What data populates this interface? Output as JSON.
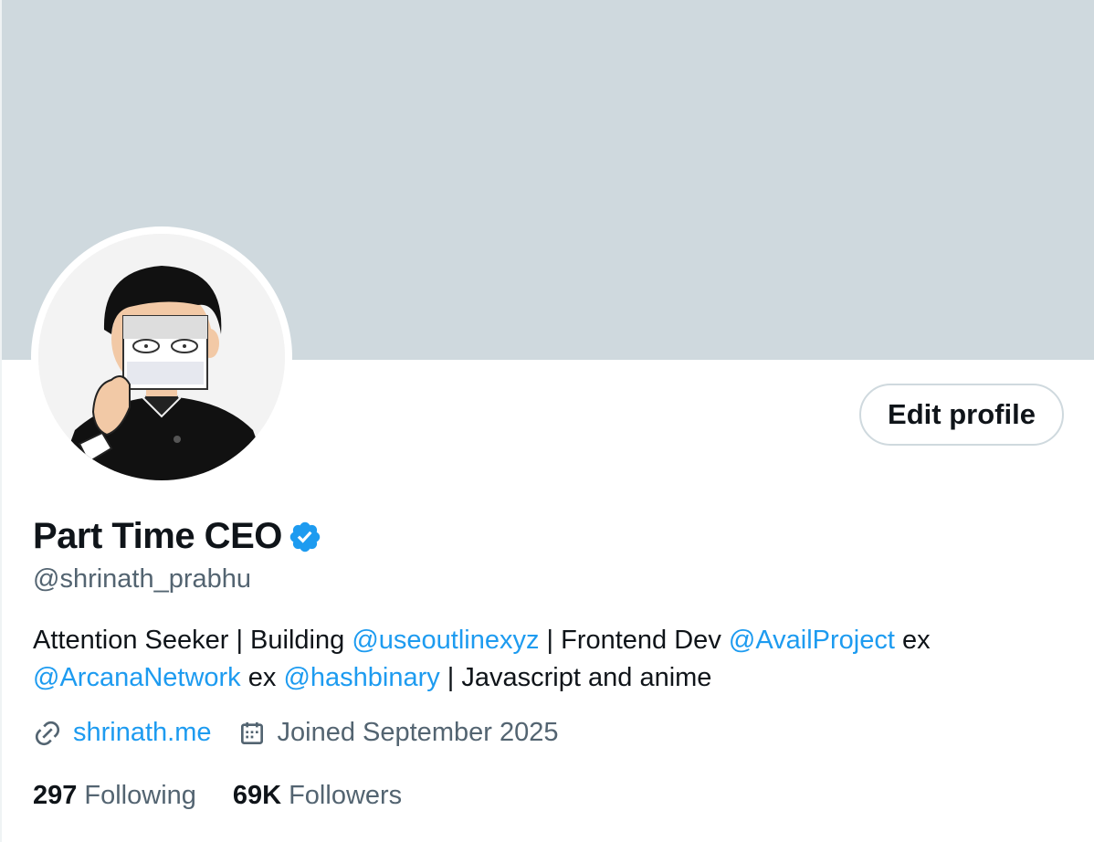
{
  "profile": {
    "display_name": "Part Time CEO",
    "handle": "@shrinath_prabhu",
    "edit_button_label": "Edit profile",
    "bio": {
      "t1": "Attention Seeker | Building ",
      "m1": "@useoutlinexyz",
      "t2": " | Frontend Dev ",
      "m2": "@AvailProject",
      "t3": " ex ",
      "m3": "@ArcanaNetwork",
      "t4": " ex ",
      "m4": "@hashbinary",
      "t5": " | Javascript and anime"
    },
    "website": "shrinath.me",
    "joined": "Joined September 2025",
    "following_count": "297",
    "following_label": "Following",
    "followers_count": "69K",
    "followers_label": "Followers"
  },
  "icons": {
    "verified": "verified-badge-icon",
    "link": "link-icon",
    "calendar": "calendar-icon"
  },
  "colors": {
    "banner": "#cfd9de",
    "accent": "#1d9bf0",
    "secondary_text": "#536471",
    "primary_text": "#0f1419"
  }
}
